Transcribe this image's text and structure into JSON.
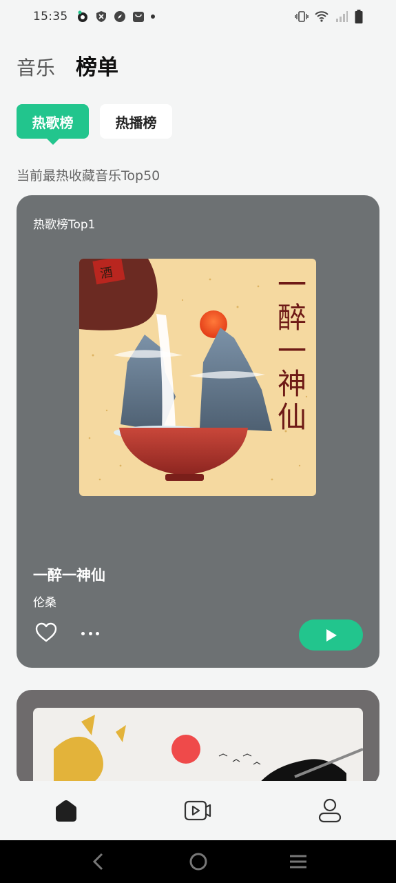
{
  "status_bar": {
    "time": "15:35",
    "left_icons": [
      "app-notification-icon",
      "shield-icon",
      "compass-icon",
      "bag-icon",
      "dot-icon"
    ],
    "right_icons": [
      "vibrate-icon",
      "wifi-icon",
      "signal-icon",
      "battery-icon"
    ]
  },
  "header": {
    "tab_music": "音乐",
    "tab_chart": "榜单"
  },
  "chips": {
    "hot_songs": "热歌榜",
    "hot_plays": "热播榜"
  },
  "subtitle": "当前最热收藏音乐Top50",
  "card1": {
    "label": "热歌榜Top1",
    "cover_text": "一醉一神仙",
    "title": "一醉一神仙",
    "artist": "伦桑",
    "icons": {
      "like": "heart-icon",
      "more": "more-icon",
      "play": "play-icon"
    }
  },
  "bottom_nav": {
    "items": [
      "home-icon",
      "video-icon",
      "profile-icon"
    ]
  },
  "system_nav": {
    "items": [
      "back-icon",
      "home-circle-icon",
      "menu-icon"
    ]
  },
  "colors": {
    "accent": "#22c58d",
    "card1_bg": "#6d7173",
    "card2_bg": "#6e6b6c",
    "page_bg": "#f4f5f5"
  }
}
